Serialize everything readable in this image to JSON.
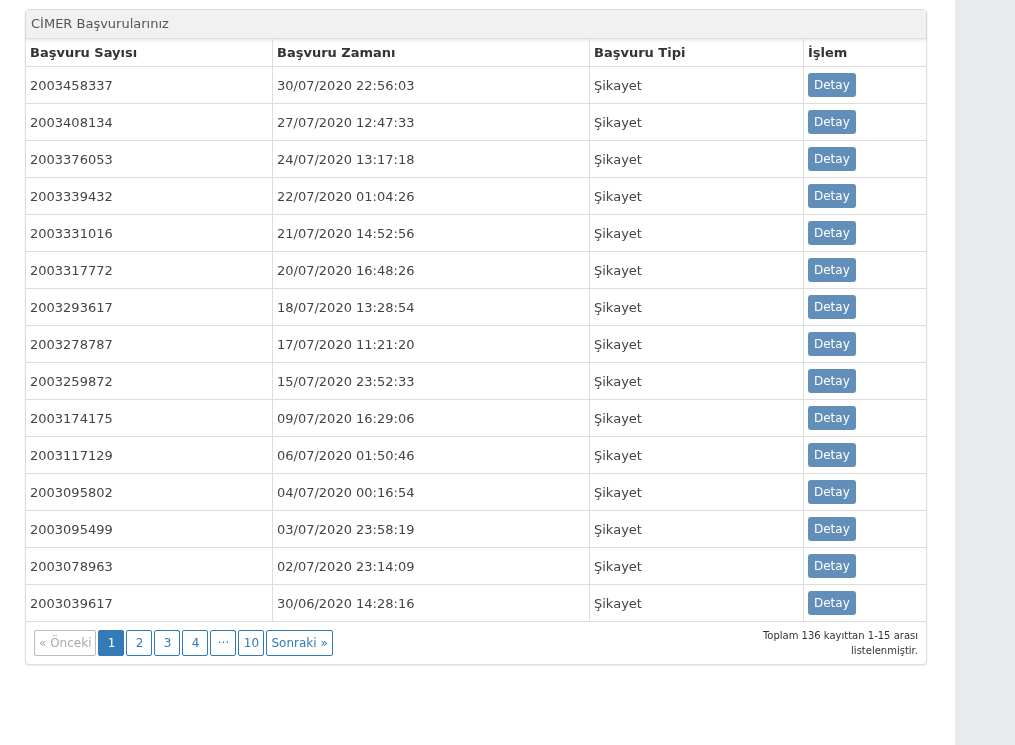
{
  "panel": {
    "title": "CİMER Başvurularınız"
  },
  "table": {
    "columns": [
      "Başvuru Sayısı",
      "Başvuru Zamanı",
      "Başvuru Tipi",
      "İşlem"
    ],
    "rows": [
      {
        "number": "2003458337",
        "time": "30/07/2020 22:56:03",
        "type": "Şikayet",
        "action": "Detay"
      },
      {
        "number": "2003408134",
        "time": "27/07/2020 12:47:33",
        "type": "Şikayet",
        "action": "Detay"
      },
      {
        "number": "2003376053",
        "time": "24/07/2020 13:17:18",
        "type": "Şikayet",
        "action": "Detay"
      },
      {
        "number": "2003339432",
        "time": "22/07/2020 01:04:26",
        "type": "Şikayet",
        "action": "Detay"
      },
      {
        "number": "2003331016",
        "time": "21/07/2020 14:52:56",
        "type": "Şikayet",
        "action": "Detay"
      },
      {
        "number": "2003317772",
        "time": "20/07/2020 16:48:26",
        "type": "Şikayet",
        "action": "Detay"
      },
      {
        "number": "2003293617",
        "time": "18/07/2020 13:28:54",
        "type": "Şikayet",
        "action": "Detay"
      },
      {
        "number": "2003278787",
        "time": "17/07/2020 11:21:20",
        "type": "Şikayet",
        "action": "Detay"
      },
      {
        "number": "2003259872",
        "time": "15/07/2020 23:52:33",
        "type": "Şikayet",
        "action": "Detay"
      },
      {
        "number": "2003174175",
        "time": "09/07/2020 16:29:06",
        "type": "Şikayet",
        "action": "Detay"
      },
      {
        "number": "2003117129",
        "time": "06/07/2020 01:50:46",
        "type": "Şikayet",
        "action": "Detay"
      },
      {
        "number": "2003095802",
        "time": "04/07/2020 00:16:54",
        "type": "Şikayet",
        "action": "Detay"
      },
      {
        "number": "2003095499",
        "time": "03/07/2020 23:58:19",
        "type": "Şikayet",
        "action": "Detay"
      },
      {
        "number": "2003078963",
        "time": "02/07/2020 23:14:09",
        "type": "Şikayet",
        "action": "Detay"
      },
      {
        "number": "2003039617",
        "time": "30/06/2020 14:28:16",
        "type": "Şikayet",
        "action": "Detay"
      }
    ]
  },
  "pagination": [
    {
      "label": "« Önceki",
      "selected": false,
      "disabled": true
    },
    {
      "label": "1",
      "selected": true,
      "disabled": false
    },
    {
      "label": "2",
      "selected": false,
      "disabled": false
    },
    {
      "label": "3",
      "selected": false,
      "disabled": false
    },
    {
      "label": "4",
      "selected": false,
      "disabled": false
    },
    {
      "label": "···",
      "selected": false,
      "disabled": false
    },
    {
      "label": "10",
      "selected": false,
      "disabled": false
    },
    {
      "label": "Sonraki »",
      "selected": false,
      "disabled": false
    }
  ],
  "summary": "Toplam 136 kayıttan 1-15 arası listelenmiştir."
}
